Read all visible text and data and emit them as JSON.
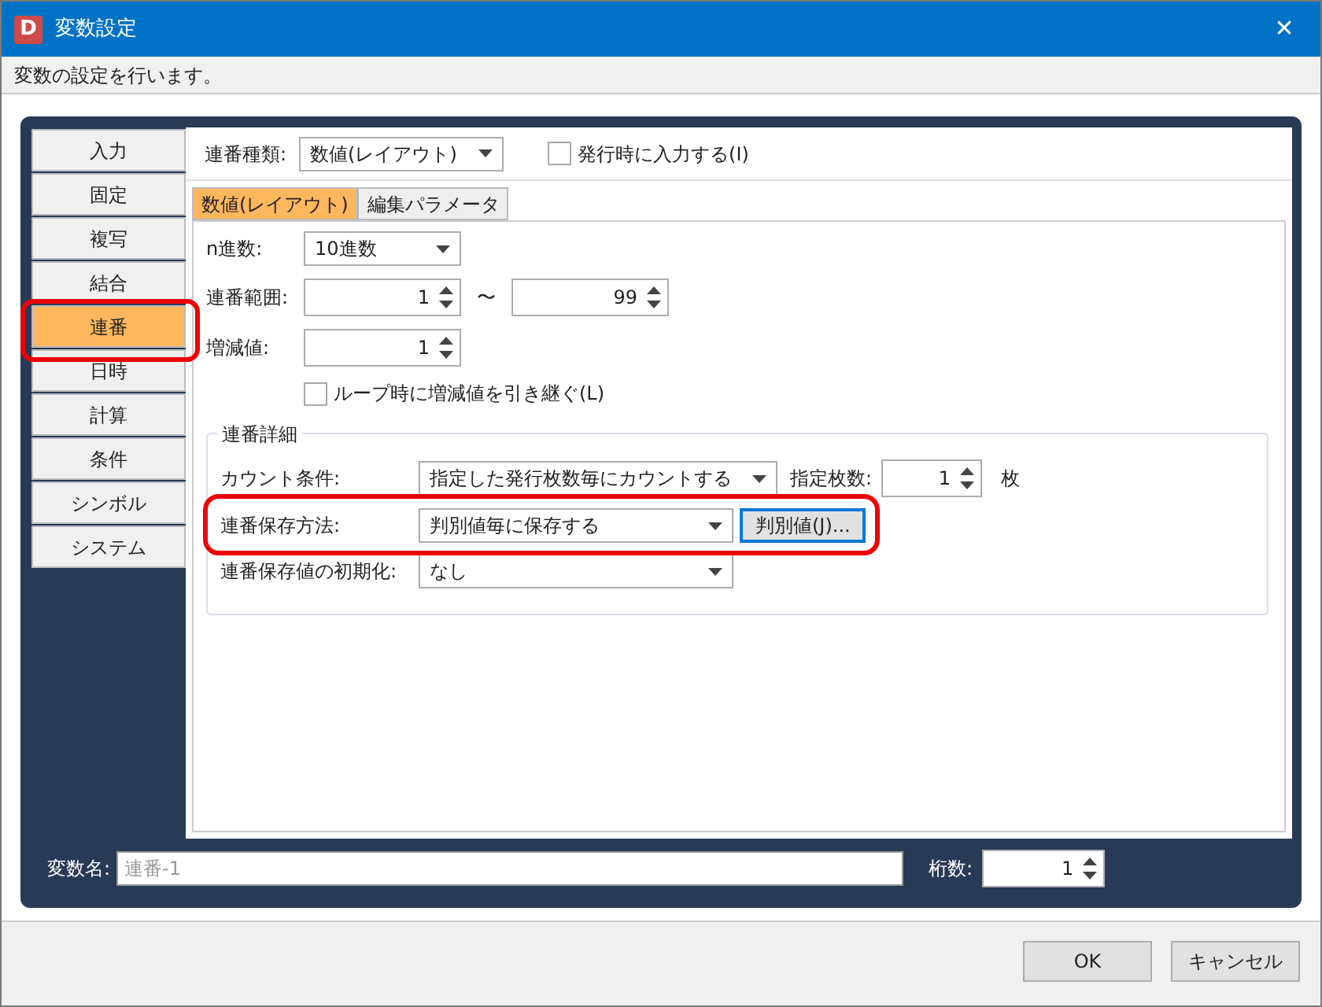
{
  "window": {
    "icon_letter": "D",
    "title": "変数設定",
    "close": "✕"
  },
  "description": "変数の設定を行います。",
  "sidebar": {
    "items": [
      {
        "label": "入力",
        "selected": false
      },
      {
        "label": "固定",
        "selected": false
      },
      {
        "label": "複写",
        "selected": false
      },
      {
        "label": "結合",
        "selected": false
      },
      {
        "label": "連番",
        "selected": true
      },
      {
        "label": "日時",
        "selected": false
      },
      {
        "label": "計算",
        "selected": false
      },
      {
        "label": "条件",
        "selected": false
      },
      {
        "label": "シンボル",
        "selected": false
      },
      {
        "label": "システム",
        "selected": false
      }
    ]
  },
  "serial_type": {
    "label": "連番種類:",
    "value": "数値(レイアウト)"
  },
  "input_on_issue": {
    "label": "発行時に入力する(I)",
    "checked": false
  },
  "tabs": [
    {
      "label": "数値(レイアウト)",
      "selected": true
    },
    {
      "label": "編集パラメータ",
      "selected": false
    }
  ],
  "radix": {
    "label": "n進数:",
    "value": "10進数"
  },
  "range": {
    "label": "連番範囲:",
    "from": "1",
    "separator": "〜",
    "to": "99"
  },
  "step": {
    "label": "増減値:",
    "value": "1"
  },
  "carry_over": {
    "label": "ループ時に増減値を引き継ぐ(L)",
    "checked": false
  },
  "details": {
    "title": "連番詳細",
    "count_condition": {
      "label": "カウント条件:",
      "value": "指定した発行枚数毎にカウントする",
      "count_label": "指定枚数:",
      "count": "1",
      "unit": "枚"
    },
    "save_method": {
      "label": "連番保存方法:",
      "value": "判別値毎に保存する",
      "button": "判別値(J)..."
    },
    "reset": {
      "label": "連番保存値の初期化:",
      "value": "なし"
    }
  },
  "variable_name": {
    "label": "変数名:",
    "placeholder": "連番-1"
  },
  "digits": {
    "label": "桁数:",
    "value": "1"
  },
  "buttons": [
    "OK",
    "キャンセル"
  ]
}
